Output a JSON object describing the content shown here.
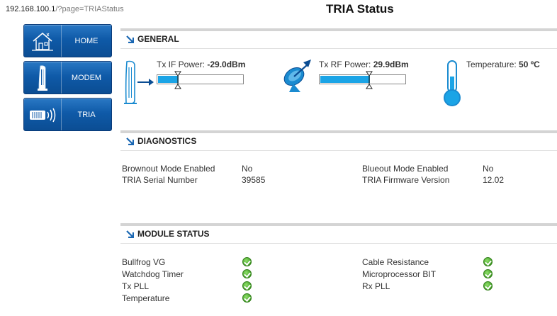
{
  "address": {
    "host": "192.168.100.1",
    "path": "/?page=TRIAStatus"
  },
  "page_title": "TRIA Status",
  "nav": {
    "items": [
      {
        "label": "HOME",
        "icon": "house-icon"
      },
      {
        "label": "MODEM",
        "icon": "modem-icon"
      },
      {
        "label": "TRIA",
        "icon": "tria-icon"
      }
    ]
  },
  "general": {
    "title": "GENERAL",
    "tx_if": {
      "label": "Tx IF Power:",
      "value": "-29.0dBm",
      "fill_fraction": 0.24
    },
    "tx_rf": {
      "label": "Tx RF Power:",
      "value": "29.9dBm",
      "fill_fraction": 0.58
    },
    "temperature": {
      "label": "Temperature:",
      "value": "50 ºC"
    }
  },
  "diagnostics": {
    "title": "DIAGNOSTICS",
    "rows": [
      {
        "label": "Brownout Mode Enabled",
        "value": "No"
      },
      {
        "label": "TRIA Serial Number",
        "value": "39585"
      },
      {
        "label": "Blueout Mode Enabled",
        "value": "No"
      },
      {
        "label": "TRIA Firmware Version",
        "value": "12.02"
      }
    ]
  },
  "module_status": {
    "title": "MODULE STATUS",
    "items": [
      {
        "label": "Bullfrog VG",
        "status": "ok"
      },
      {
        "label": "Watchdog Timer",
        "status": "ok"
      },
      {
        "label": "Tx PLL",
        "status": "ok"
      },
      {
        "label": "Temperature",
        "status": "ok"
      },
      {
        "label": "Cable Resistance",
        "status": "ok"
      },
      {
        "label": "Microprocessor BIT",
        "status": "ok"
      },
      {
        "label": "Rx PLL",
        "status": "ok"
      }
    ]
  },
  "colors": {
    "nav_blue": "#0f5aa8",
    "meter_fill": "#1ba4e6",
    "ok_green": "#3f9a22"
  }
}
